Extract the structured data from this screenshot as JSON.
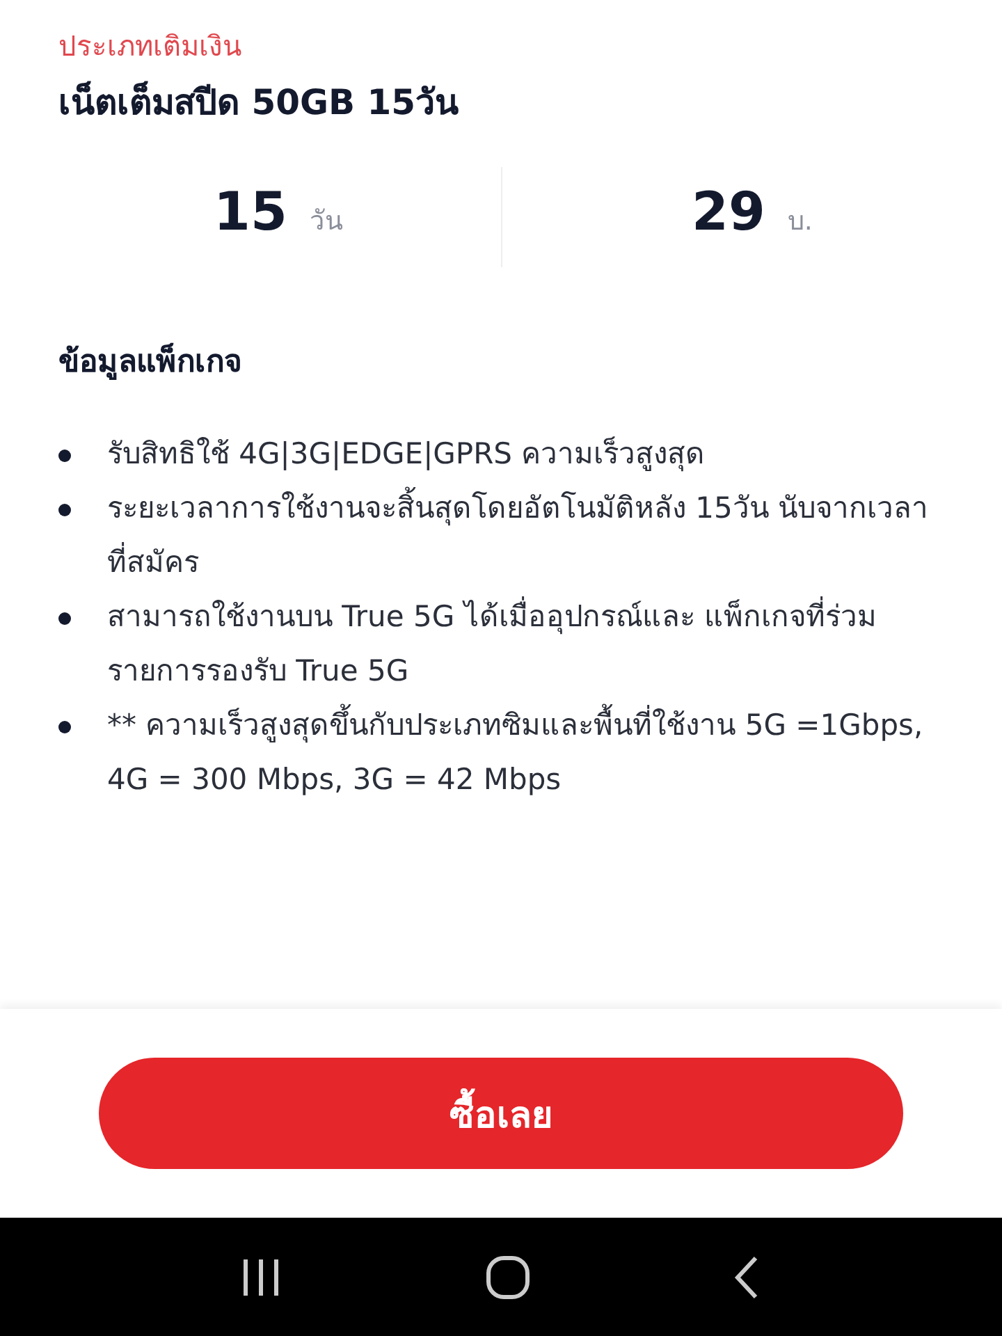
{
  "package": {
    "category": "ประเภทเติมเงิน",
    "title": "เน็ตเต็มสปีด 50GB 15วัน"
  },
  "stats": [
    {
      "value": "15",
      "unit": "วัน"
    },
    {
      "value": "29",
      "unit": "บ."
    }
  ],
  "details": {
    "heading": "ข้อมูลแพ็กเกจ",
    "items": [
      "รับสิทธิใช้ 4G|3G|EDGE|GPRS ความเร็วสูงสุด",
      "ระยะเวลาการใช้งานจะสิ้นสุดโดยอัตโนมัติหลัง 15วัน นับจากเวลาที่สมัคร",
      "สามารถใช้งานบน True 5G ได้เมื่ออุปกรณ์และ แพ็กเกจที่ร่วมรายการรองรับ True 5G",
      "** ความเร็วสูงสุดขึ้นกับประเภทซิมและพื้นที่ใช้งาน 5G =1Gbps, 4G = 300 Mbps, 3G = 42 Mbps"
    ]
  },
  "buy_button": "ซื้อเลย"
}
